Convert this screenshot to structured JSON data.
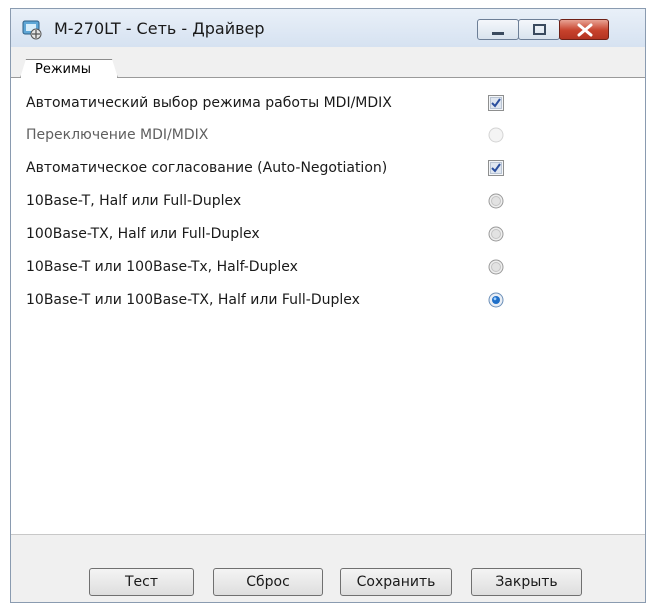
{
  "window": {
    "title": "M-270LT - Сеть - Драйвер"
  },
  "tabs": [
    {
      "label": "Режимы",
      "active": true
    }
  ],
  "options": [
    {
      "label": "Автоматический выбор режима работы MDI/MDIX",
      "control": "checkbox",
      "checked": true,
      "enabled": true
    },
    {
      "label": "Переключение MDI/MDIX",
      "control": "radio",
      "checked": false,
      "enabled": false
    },
    {
      "label": "Автоматическое согласование (Auto-Negotiation)",
      "control": "checkbox",
      "checked": true,
      "enabled": true
    },
    {
      "label": "10Base-T, Half или Full-Duplex",
      "control": "radio",
      "checked": false,
      "enabled": true
    },
    {
      "label": "100Base-TX, Half или Full-Duplex",
      "control": "radio",
      "checked": false,
      "enabled": true
    },
    {
      "label": "10Base-T или 100Base-Tx, Half-Duplex",
      "control": "radio",
      "checked": false,
      "enabled": true
    },
    {
      "label": "10Base-T или 100Base-TX, Half или Full-Duplex",
      "control": "radio",
      "checked": true,
      "enabled": true
    }
  ],
  "buttons": {
    "test": "Тест",
    "reset": "Сброс",
    "save": "Сохранить",
    "close": "Закрыть"
  },
  "icons": {
    "app": "network-driver-icon",
    "minimize": "minimize-icon",
    "maximize": "maximize-icon",
    "close": "close-icon"
  },
  "colors": {
    "close_button": "#c7422c",
    "check_mark": "#2b4f9e",
    "radio_selected": "#1f6fc8"
  }
}
